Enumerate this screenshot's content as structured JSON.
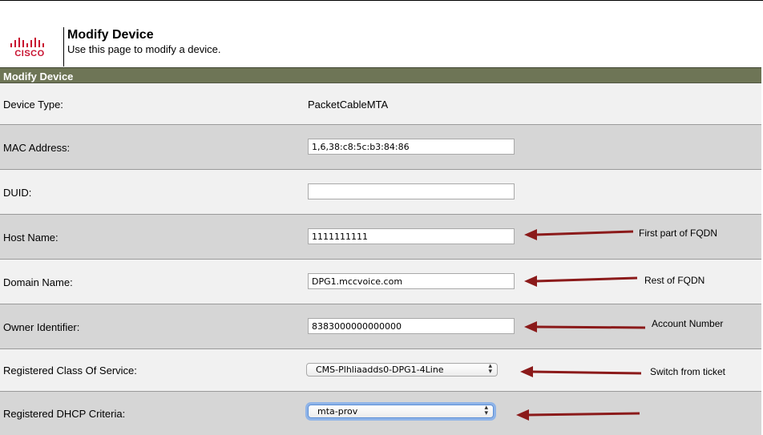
{
  "header": {
    "logo_text": "CISCO",
    "title": "Modify Device",
    "subtitle": "Use this page to modify a device."
  },
  "section": {
    "title": "Modify Device"
  },
  "fields": {
    "device_type": {
      "label": "Device Type:",
      "value": "PacketCableMTA"
    },
    "mac_address": {
      "label": "MAC Address:",
      "value": "1,6,38:c8:5c:b3:84:86"
    },
    "duid": {
      "label": "DUID:",
      "value": ""
    },
    "host_name": {
      "label": "Host Name:",
      "value": "1111111111"
    },
    "domain_name": {
      "label": "Domain Name:",
      "value": "DPG1.mccvoice.com"
    },
    "owner_identifier": {
      "label": "Owner Identifier:",
      "value": "8383000000000000"
    },
    "class_of_service": {
      "label": "Registered Class Of Service:",
      "value": "CMS-Plhliaadds0-DPG1-4Line"
    },
    "dhcp_criteria": {
      "label": "Registered DHCP Criteria:",
      "value": "mta-prov"
    }
  },
  "annotations": {
    "host_name": "First part of FQDN",
    "domain_name": "Rest of FQDN",
    "owner_identifier": "Account Number",
    "class_of_service": "Switch from ticket"
  },
  "colors": {
    "section_bar": "#6e7556",
    "arrow": "#8b1a1a",
    "logo": "#c8102e"
  },
  "icons": {
    "logo": "cisco-logo",
    "select_chevron": "updown-chevron-icon",
    "arrow": "left-arrow"
  }
}
